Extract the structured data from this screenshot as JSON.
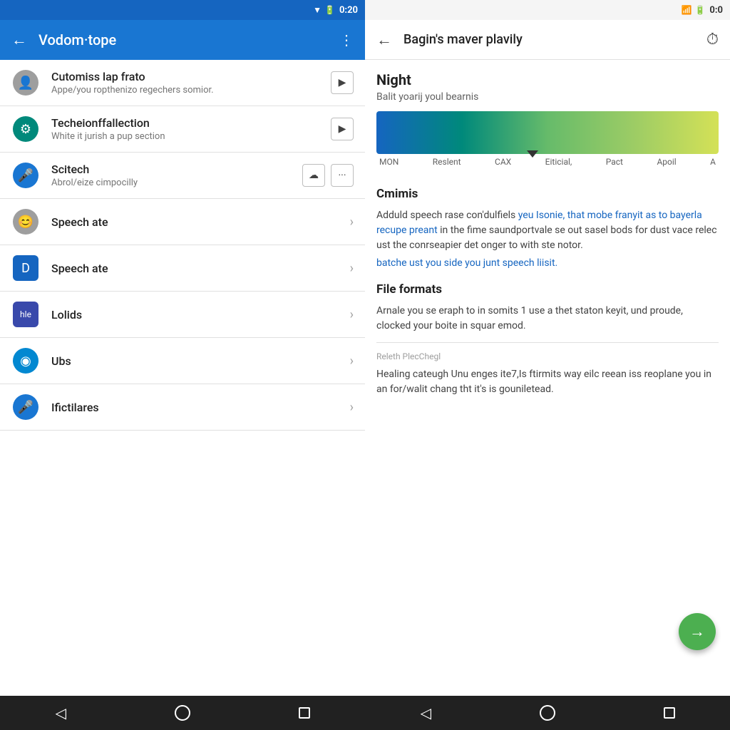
{
  "left_status": {
    "time": "0:20",
    "icons": [
      "▼",
      "🔋"
    ]
  },
  "right_status": {
    "time": "0:0",
    "icons": [
      "📶",
      "🔋"
    ]
  },
  "left_header": {
    "title": "Vodom·tope",
    "back_label": "←",
    "menu_icon": "⋮"
  },
  "right_header": {
    "title": "Bagin's maver plavily",
    "back_label": "←",
    "clock_icon": "⏱"
  },
  "menu_items": [
    {
      "id": "item1",
      "title": "Cutomiss lap frato",
      "subtitle": "Appe/you ropthenizo regechers somior.",
      "icon": "👤",
      "icon_style": "icon-gray",
      "has_play": true,
      "has_more": false,
      "has_chevron": false
    },
    {
      "id": "item2",
      "title": "Techeionffallection",
      "subtitle": "White it jurish a pup section",
      "icon": "⚙",
      "icon_style": "icon-teal",
      "has_play": true,
      "has_more": false,
      "has_chevron": false
    },
    {
      "id": "item3",
      "title": "Scitech",
      "subtitle": "Abrol/eize cimpocilly",
      "icon": "🎤",
      "icon_style": "icon-blue",
      "has_play": false,
      "has_more": true,
      "has_chevron": false
    },
    {
      "id": "item4",
      "title": "Speech ate",
      "subtitle": "",
      "icon": "😊",
      "icon_style": "icon-gray",
      "has_play": false,
      "has_more": false,
      "has_chevron": true
    },
    {
      "id": "item5",
      "title": "Speech ate",
      "subtitle": "",
      "icon": "D",
      "icon_style": "icon-blue2",
      "has_play": false,
      "has_more": false,
      "has_chevron": true
    },
    {
      "id": "item6",
      "title": "Lolids",
      "subtitle": "",
      "icon": "hle",
      "icon_style": "icon-indigo",
      "has_play": false,
      "has_more": false,
      "has_chevron": true
    },
    {
      "id": "item7",
      "title": "Ubs",
      "subtitle": "",
      "icon": "◉",
      "icon_style": "icon-blue3",
      "has_play": false,
      "has_more": false,
      "has_chevron": true
    },
    {
      "id": "item8",
      "title": "Ifictilares",
      "subtitle": "",
      "icon": "🎤",
      "icon_style": "icon-blue",
      "has_play": false,
      "has_more": false,
      "has_chevron": true
    }
  ],
  "right_content": {
    "section1_title": "Night",
    "section1_subtitle": "Balit yoarij youl bearnis",
    "chart_labels": [
      "MON",
      "Reslent",
      "CAX",
      "Eiticial,",
      "Pact",
      "Apoil",
      "A"
    ],
    "section2_title": "Cmimis",
    "section2_text1": "Adduld speech rase con'dulfiels ",
    "section2_text1_blue": "yeu Isonie, that mobe franyit as to bayerla recupe preant",
    "section2_text1_rest": " in the fime saundportvale se out sasel bods for dust vace relec ust the conrseapier det onger to with ste notor.",
    "section2_text2_blue": "batche ust you side you junt speech liisit.",
    "section3_title": "File formats",
    "section3_text1": "Arnale you se eraph to in somits 1 use a thet staton keyit, und proude, clocked your boite in squar emod.",
    "small_label": "Releth PlecChegl",
    "section3_text2": "Healing cateugh Unu enges ite7,Is ftirmits way eilc reean iss reoplane you in an for/walit chang tht it's is gouniletead.",
    "fab_label": "→"
  },
  "nav": {
    "back": "◁",
    "home_label": "home",
    "square_label": "recents"
  }
}
